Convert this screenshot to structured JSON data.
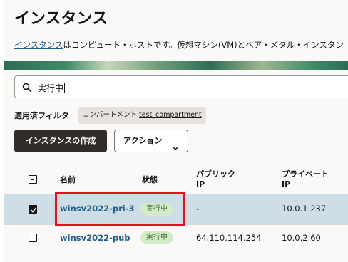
{
  "header": {
    "title": "インスタンス",
    "description_link": "インスタンス",
    "description_rest": "はコンピュート・ホストです。仮想マシン(VM)とベア・メタル・インスタン"
  },
  "search": {
    "value": "実行中",
    "icon": "search-icon"
  },
  "filters": {
    "label": "適用済フィルタ",
    "chip_key": "コンパートメント",
    "chip_value": "test_compartment"
  },
  "toolbar": {
    "create_label": "インスタンスの作成",
    "action_label": "アクション"
  },
  "table": {
    "headers": {
      "name": "名前",
      "state": "状態",
      "public_ip_1": "パブリック",
      "public_ip_2": "IP",
      "private_ip_1": "プライベート",
      "private_ip_2": "IP"
    },
    "rows": [
      {
        "name": "winsv2022-pri-3",
        "state": "実行中",
        "public_ip": "-",
        "private_ip": "10.0.1.237",
        "selected": true
      },
      {
        "name": "winsv2022-pub",
        "state": "実行中",
        "public_ip": "64.110.114.254",
        "private_ip": "10.0.2.60",
        "selected": false
      }
    ]
  },
  "colors": {
    "link": "#1f5f8b",
    "badge_bg": "#d4ebca",
    "badge_text": "#3b6e2e",
    "selected_row": "#cfdde6",
    "highlight": "#e0141e"
  }
}
